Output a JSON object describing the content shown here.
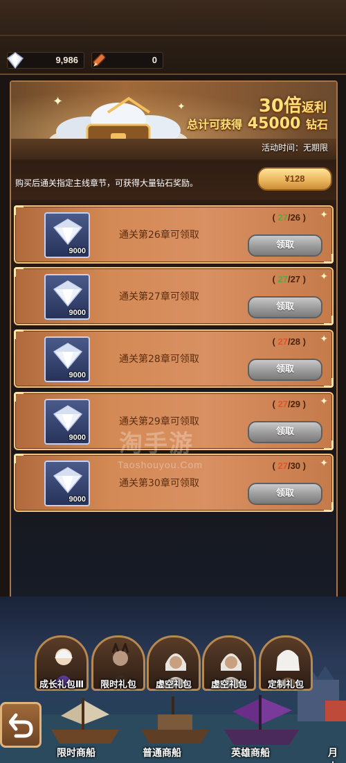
{
  "currencies": [
    {
      "name": "diamond-icon",
      "value": "9,986"
    },
    {
      "name": "pencil-icon",
      "value": "0"
    }
  ],
  "banner": {
    "multiplier": "30倍",
    "multiplier_suffix": "返利",
    "total_prefix": "总计可获得",
    "total_amount": "45000",
    "total_suffix": "钻石",
    "time_label": "活动时间：无期限"
  },
  "description": "购买后通关指定主线章节，可获得大量钻石奖励。",
  "price_label": "¥128",
  "rewards": [
    {
      "amount": "9000",
      "label": "通关第26章可领取",
      "current": "27",
      "required": "/26",
      "claim_label": "领取",
      "reached": true
    },
    {
      "amount": "9000",
      "label": "通关第27章可领取",
      "current": "27",
      "required": "/27",
      "claim_label": "领取",
      "reached": true
    },
    {
      "amount": "9000",
      "label": "通关第28章可领取",
      "current": "27",
      "required": "/28",
      "claim_label": "领取",
      "reached": false
    },
    {
      "amount": "9000",
      "label": "通关第29章可领取",
      "current": "27",
      "required": "/29",
      "claim_label": "领取",
      "reached": false
    },
    {
      "amount": "9000",
      "label": "通关第30章可领取",
      "current": "27",
      "required": "/30",
      "claim_label": "领取",
      "reached": false
    }
  ],
  "watermark": {
    "cn": "淘手游",
    "en": "Taoshouyou.Com"
  },
  "gift_tabs": [
    "成长礼包Ⅲ",
    "限时礼包",
    "虚空礼包",
    "虚空礼包",
    "定制礼包"
  ],
  "ships": [
    "限时商船",
    "普通商船",
    "英雄商船",
    "月十"
  ],
  "colors": {
    "accent_gold": "#ffe07a",
    "reached": "#4fae3a",
    "not_reached": "#e0542a"
  }
}
